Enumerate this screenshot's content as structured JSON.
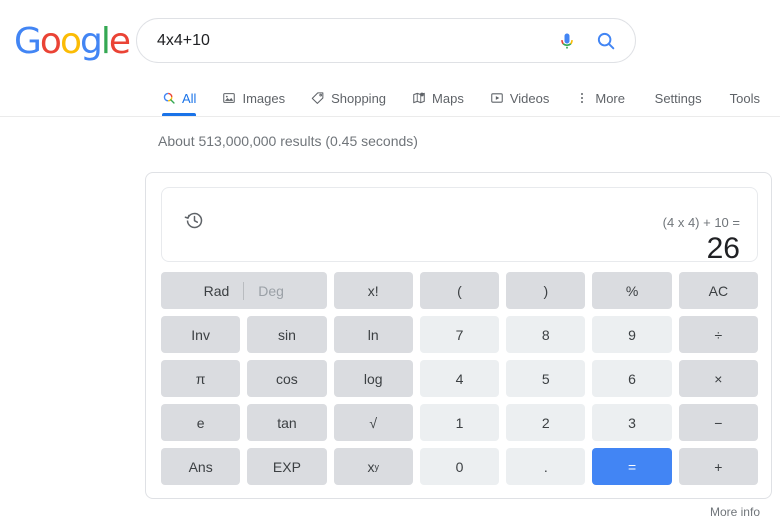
{
  "brand": {
    "name": "Google",
    "letters": [
      {
        "ch": "G",
        "color": "#4285F4"
      },
      {
        "ch": "o",
        "color": "#EA4335"
      },
      {
        "ch": "o",
        "color": "#FBBC05"
      },
      {
        "ch": "g",
        "color": "#4285F4"
      },
      {
        "ch": "l",
        "color": "#34A853"
      },
      {
        "ch": "e",
        "color": "#EA4335"
      }
    ]
  },
  "search": {
    "value": "4x4+10",
    "placeholder": "Search",
    "mic_icon": "microphone-icon",
    "search_icon": "search-icon"
  },
  "nav": {
    "tabs": [
      {
        "label": "All",
        "icon": "search-icon",
        "active": true
      },
      {
        "label": "Images",
        "icon": "image-icon",
        "active": false
      },
      {
        "label": "Shopping",
        "icon": "tag-icon",
        "active": false
      },
      {
        "label": "Maps",
        "icon": "map-pin-icon",
        "active": false
      },
      {
        "label": "Videos",
        "icon": "video-icon",
        "active": false
      },
      {
        "label": "More",
        "icon": "kebab-menu-icon",
        "active": false
      }
    ],
    "settings_label": "Settings",
    "tools_label": "Tools"
  },
  "results": {
    "count_text": "About 513,000,000 results (0.45 seconds)"
  },
  "calculator": {
    "history_icon": "history-icon",
    "expression": "(4 x 4) + 10 =",
    "result": "26",
    "mode": {
      "rad": "Rad",
      "deg": "Deg",
      "active": "Rad"
    },
    "keys": [
      {
        "label": "Rad",
        "type": "radeg",
        "name": "rad-deg-toggle"
      },
      {
        "label": "x!",
        "type": "fn",
        "name": "factorial-key"
      },
      {
        "label": "(",
        "type": "fn",
        "name": "open-paren-key"
      },
      {
        "label": ")",
        "type": "fn",
        "name": "close-paren-key"
      },
      {
        "label": "%",
        "type": "fn",
        "name": "percent-key"
      },
      {
        "label": "AC",
        "type": "fn",
        "name": "all-clear-key"
      },
      {
        "label": "Inv",
        "type": "fn",
        "name": "inverse-key"
      },
      {
        "label": "sin",
        "type": "fn",
        "name": "sin-key"
      },
      {
        "label": "ln",
        "type": "fn",
        "name": "ln-key"
      },
      {
        "label": "7",
        "type": "num",
        "name": "digit-7-key"
      },
      {
        "label": "8",
        "type": "num",
        "name": "digit-8-key"
      },
      {
        "label": "9",
        "type": "num",
        "name": "digit-9-key"
      },
      {
        "label": "÷",
        "type": "fn",
        "name": "divide-key"
      },
      {
        "label": "π",
        "type": "fn",
        "name": "pi-key"
      },
      {
        "label": "cos",
        "type": "fn",
        "name": "cos-key"
      },
      {
        "label": "log",
        "type": "fn",
        "name": "log-key"
      },
      {
        "label": "4",
        "type": "num",
        "name": "digit-4-key"
      },
      {
        "label": "5",
        "type": "num",
        "name": "digit-5-key"
      },
      {
        "label": "6",
        "type": "num",
        "name": "digit-6-key"
      },
      {
        "label": "×",
        "type": "fn",
        "name": "multiply-key"
      },
      {
        "label": "e",
        "type": "fn",
        "name": "euler-key"
      },
      {
        "label": "tan",
        "type": "fn",
        "name": "tan-key"
      },
      {
        "label": "√",
        "type": "fn",
        "name": "sqrt-key"
      },
      {
        "label": "1",
        "type": "num",
        "name": "digit-1-key"
      },
      {
        "label": "2",
        "type": "num",
        "name": "digit-2-key"
      },
      {
        "label": "3",
        "type": "num",
        "name": "digit-3-key"
      },
      {
        "label": "−",
        "type": "fn",
        "name": "minus-key"
      },
      {
        "label": "Ans",
        "type": "fn",
        "name": "answer-key"
      },
      {
        "label": "EXP",
        "type": "fn",
        "name": "exponent-key"
      },
      {
        "label": "x^y",
        "type": "pow",
        "name": "power-key"
      },
      {
        "label": "0",
        "type": "num",
        "name": "digit-0-key"
      },
      {
        "label": ".",
        "type": "num",
        "name": "decimal-point-key"
      },
      {
        "label": "=",
        "type": "eq",
        "name": "equals-key"
      },
      {
        "label": "+",
        "type": "fn",
        "name": "plus-key"
      }
    ]
  },
  "footer": {
    "more_info": "More info"
  },
  "colors": {
    "accent_blue": "#4285F4",
    "link_blue": "#1a73e8",
    "key_fn_bg": "#dadce0",
    "key_num_bg": "#eceff1",
    "text_gray": "#70757a"
  }
}
